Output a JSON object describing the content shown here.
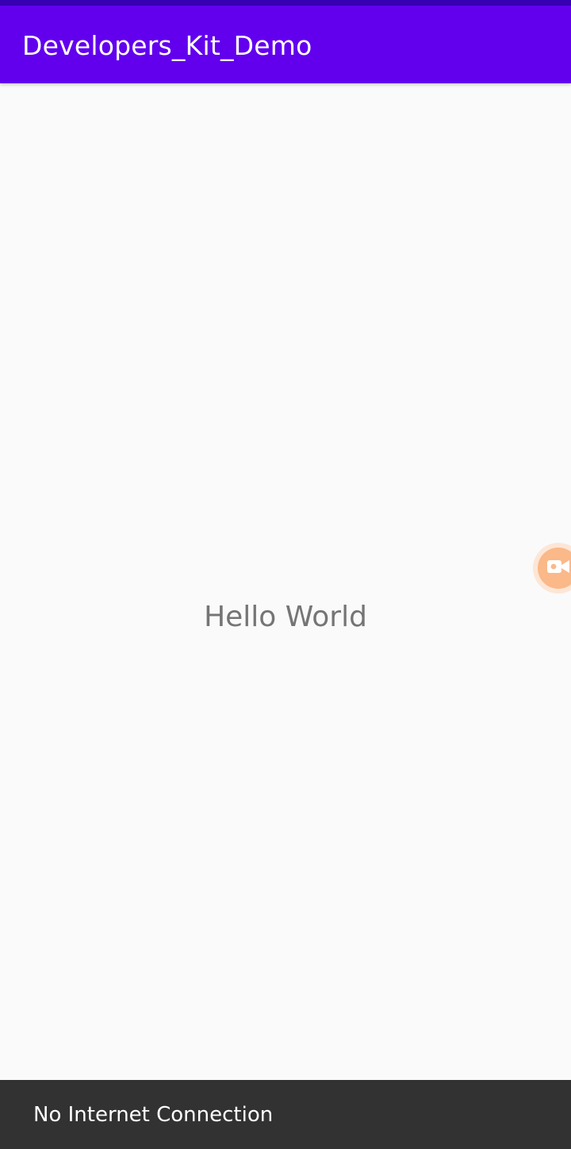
{
  "app_bar": {
    "title": "Developers_Kit_Demo"
  },
  "main": {
    "text": "Hello World"
  },
  "floating_button": {
    "icon": "video-camera-icon"
  },
  "snackbar": {
    "message": "No Internet Connection"
  },
  "colors": {
    "primary": "#6200ee",
    "primary_dark": "#3700b3",
    "background": "#fafafa",
    "snackbar": "#323232",
    "floating_button": "#fbb889"
  }
}
